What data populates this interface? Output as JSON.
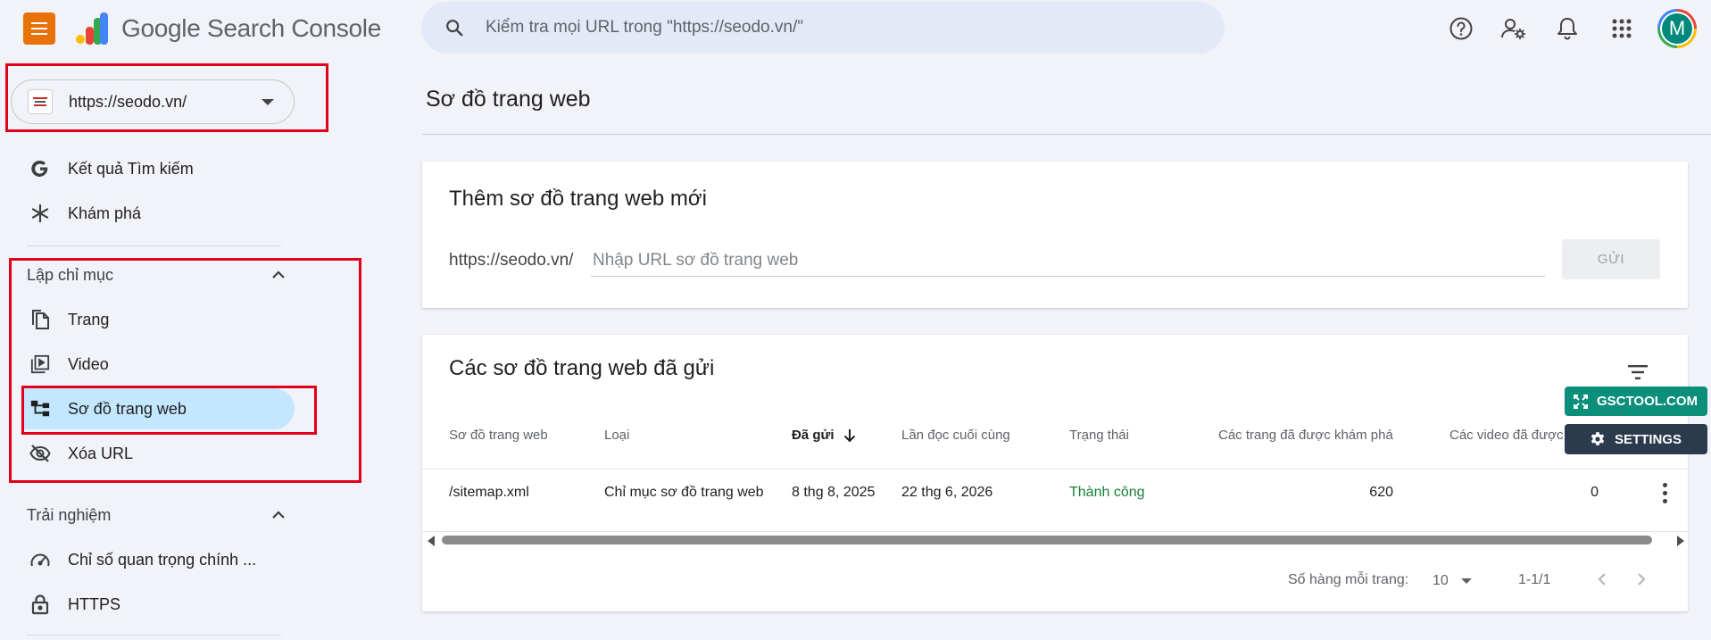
{
  "app": {
    "logo_text": "Google Search Console"
  },
  "search": {
    "placeholder": "Kiểm tra mọi URL trong \"https://seodo.vn/\""
  },
  "account": {
    "avatar_letter": "M"
  },
  "property": {
    "url": "https://seodo.vn/"
  },
  "sidebar": {
    "top_items": [
      {
        "label": "Kết quả Tìm kiếm",
        "icon": "google-g-icon"
      },
      {
        "label": "Khám phá",
        "icon": "asterisk-icon"
      }
    ],
    "sections": [
      {
        "title": "Lập chỉ mục",
        "items": [
          {
            "label": "Trang",
            "icon": "pages-icon"
          },
          {
            "label": "Video",
            "icon": "video-icon"
          },
          {
            "label": "Sơ đồ trang web",
            "icon": "sitemap-icon",
            "active": true
          },
          {
            "label": "Xóa URL",
            "icon": "eye-off-icon"
          }
        ]
      },
      {
        "title": "Trải nghiệm",
        "items": [
          {
            "label": "Chỉ số quan trọng chính ...",
            "icon": "speed-gauge-icon"
          },
          {
            "label": "HTTPS",
            "icon": "lock-icon"
          }
        ]
      }
    ]
  },
  "main": {
    "page_title": "Sơ đồ trang web",
    "add_card": {
      "title": "Thêm sơ đồ trang web mới",
      "prefix": "https://seodo.vn/",
      "input_placeholder": "Nhập URL sơ đồ trang web",
      "submit_label": "GỬI"
    },
    "list_card": {
      "title": "Các sơ đồ trang web đã gửi",
      "columns": [
        "Sơ đồ trang web",
        "Loại",
        "Đã gửi",
        "Lần đọc cuối cùng",
        "Trạng thái",
        "Các trang đã được khám phá",
        "Các video đã được"
      ],
      "rows": [
        {
          "sitemap": "/sitemap.xml",
          "type": "Chỉ mục sơ đồ trang web",
          "submitted": "8 thg 8, 2025",
          "last_read": "22 thg 6, 2026",
          "status": "Thành công",
          "pages": "620",
          "videos": "0"
        }
      ],
      "pagination": {
        "rows_label": "Số hàng mỗi trang:",
        "rows_value": "10",
        "range": "1-1/1"
      }
    }
  },
  "extension": {
    "gsctool_label": "GSCTOOL.COM",
    "settings_label": "SETTINGS"
  },
  "colors": {
    "menu_button": "#e8710a",
    "active_nav": "#c2e7ff",
    "success": "#188038",
    "highlight_box": "#e0001b",
    "gsctool": "#0b8f7a",
    "settings": "#2b3a4d"
  }
}
